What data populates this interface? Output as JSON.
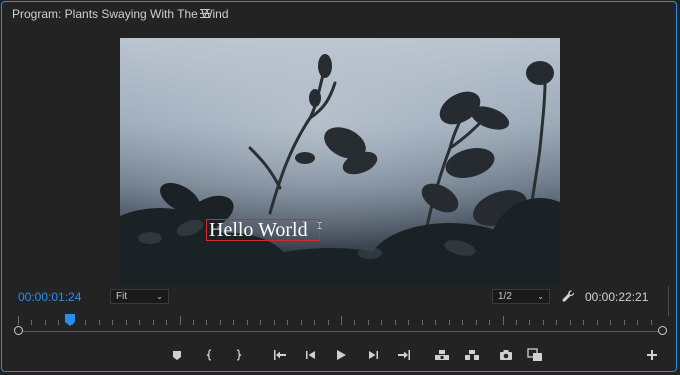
{
  "panel": {
    "title": "Program: Plants Swaying With The Wind"
  },
  "viewer": {
    "title_text": "Hello World",
    "title_box_color": "#d22b2b"
  },
  "controls": {
    "current_timecode": "00:00:01:24",
    "duration_timecode": "00:00:22:21",
    "zoom_select": "Fit",
    "resolution_select": "1/2"
  },
  "timeline": {
    "playhead_position_fraction": 0.08
  },
  "transport_buttons": [
    "add-marker",
    "mark-in",
    "mark-out",
    "go-to-in",
    "step-back",
    "play",
    "step-forward",
    "go-to-out",
    "lift",
    "extract",
    "export-frame",
    "comparison-view",
    "add-button"
  ],
  "colors": {
    "accent": "#2d8ceb",
    "background": "#232323"
  }
}
